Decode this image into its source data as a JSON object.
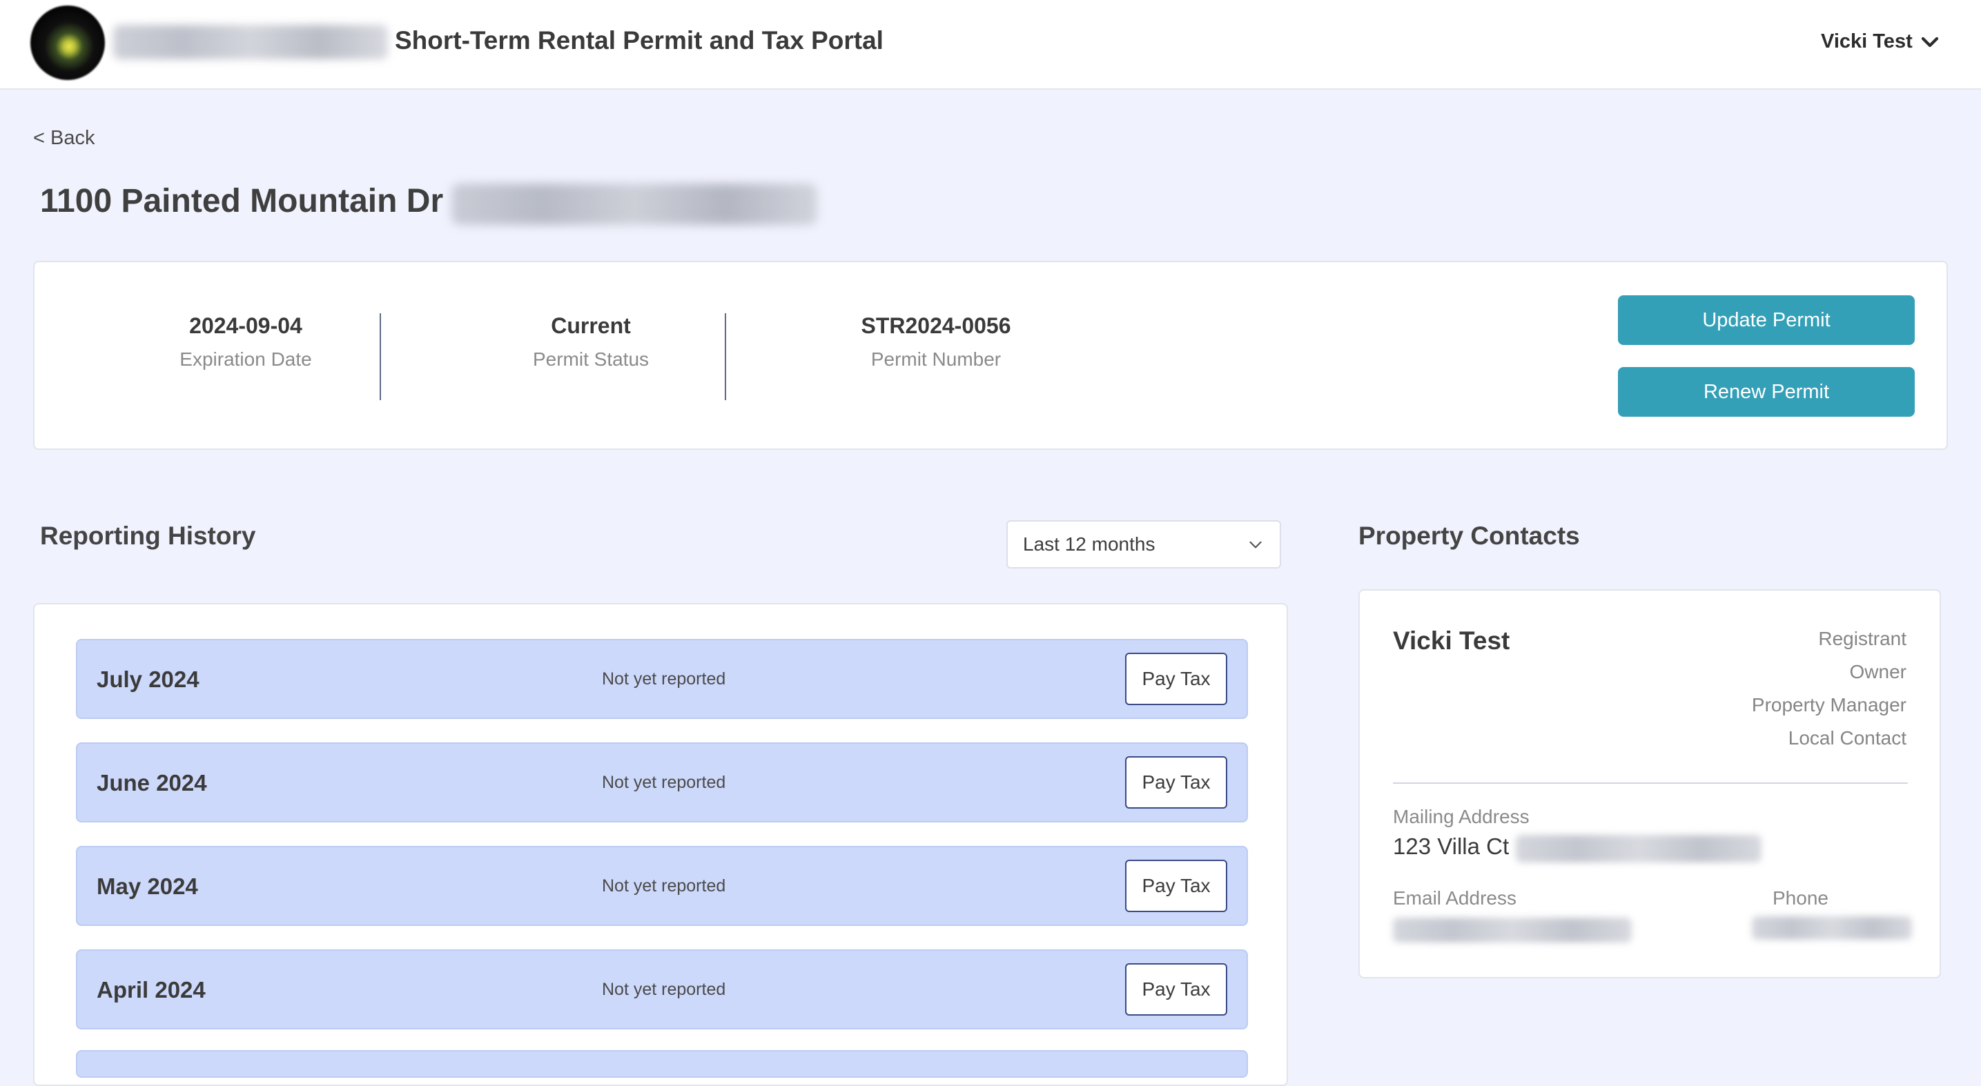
{
  "header": {
    "portal_title": "Short-Term Rental Permit and Tax Portal",
    "user_name": "Vicki Test"
  },
  "nav": {
    "back_label": "< Back"
  },
  "property": {
    "address": "1100 Painted Mountain Dr"
  },
  "permit": {
    "expiration_date": "2024-09-04",
    "expiration_label": "Expiration Date",
    "status": "Current",
    "status_label": "Permit Status",
    "number": "STR2024-0056",
    "number_label": "Permit Number",
    "update_button": "Update Permit",
    "renew_button": "Renew Permit"
  },
  "reporting": {
    "title": "Reporting History",
    "period_selected": "Last 12 months",
    "rows": [
      {
        "month": "July 2024",
        "status": "Not yet reported",
        "action": "Pay Tax"
      },
      {
        "month": "June 2024",
        "status": "Not yet reported",
        "action": "Pay Tax"
      },
      {
        "month": "May 2024",
        "status": "Not yet reported",
        "action": "Pay Tax"
      },
      {
        "month": "April 2024",
        "status": "Not yet reported",
        "action": "Pay Tax"
      }
    ]
  },
  "contacts": {
    "title": "Property Contacts",
    "name": "Vicki Test",
    "roles": [
      "Registrant",
      "Owner",
      "Property Manager",
      "Local Contact"
    ],
    "mailing_label": "Mailing Address",
    "mailing_value": "123 Villa Ct",
    "email_label": "Email Address",
    "phone_label": "Phone"
  },
  "colors": {
    "accent": "#34a0b8",
    "page_background": "#f0f2fd",
    "row_background": "#cdd9fb",
    "pay_button_border": "#3a4a86"
  }
}
